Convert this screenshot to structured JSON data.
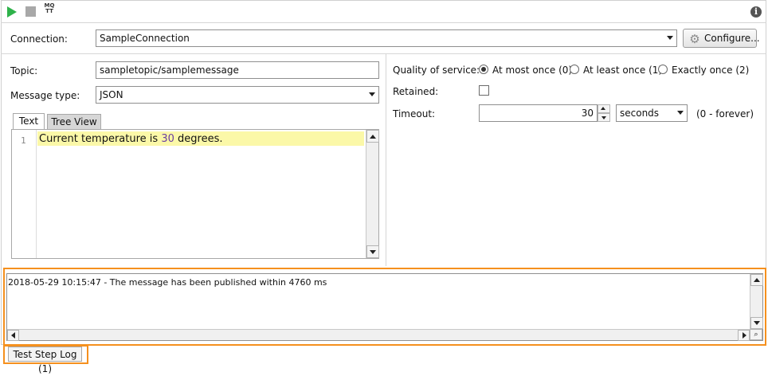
{
  "toolbar": {
    "run_icon": "play-icon",
    "stop_icon": "stop-icon",
    "mqtt_icon_text": "MQ\nTT",
    "info_icon": "info-icon"
  },
  "connection": {
    "label": "Connection:",
    "value": "SampleConnection",
    "configure_label": "Configure..."
  },
  "message": {
    "topic_label": "Topic:",
    "topic_value": "sampletopic/samplemessage",
    "type_label": "Message type:",
    "type_value": "JSON",
    "tabs": [
      {
        "label": "Text",
        "active": true
      },
      {
        "label": "Tree View",
        "active": false
      }
    ],
    "editor": {
      "line_number": "1",
      "code_prefix": "Current temperature is ",
      "code_number": "30",
      "code_suffix": " degrees."
    }
  },
  "options": {
    "qos_label": "Quality of service:",
    "qos_options": [
      {
        "label": "At most once (0)",
        "selected": true
      },
      {
        "label": "At least once (1)",
        "selected": false
      },
      {
        "label": "Exactly once (2)",
        "selected": false
      }
    ],
    "retained_label": "Retained:",
    "retained_checked": false,
    "timeout_label": "Timeout:",
    "timeout_value": "30",
    "timeout_unit": "seconds",
    "timeout_hint": "(0 - forever)"
  },
  "log": {
    "entry": "2018-05-29 10:15:47 - The message has been published within 4760 ms",
    "tab_label": "Test Step Log (1)"
  },
  "colors": {
    "highlight": "#f5901e",
    "run": "#2eb24a",
    "editor_line": "#fbf8a8"
  }
}
